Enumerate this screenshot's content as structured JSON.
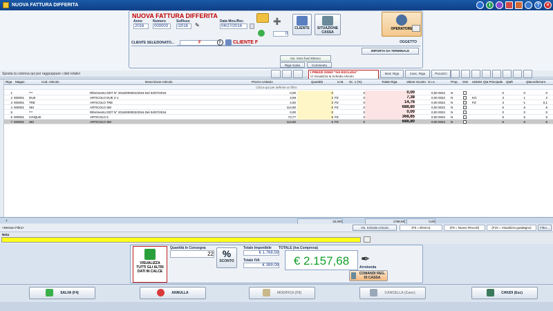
{
  "window": {
    "title": "NUOVA FATTURA DIFFERITA"
  },
  "header": {
    "doc_title": "NUOVA FATTURA DIFFERITA",
    "anno_label": "Anno",
    "anno_value": "2016",
    "numero_label": "Numero",
    "numero_value": "000003",
    "suffisso_label": "Suffisso",
    "suffisso_value": "/2016",
    "data_label": "Data Mov./Rec.",
    "data_value": "04/27/2016",
    "counter_value": "0",
    "cliente_btn": "CLIENTE",
    "situazione_btn": "SITUAZIONE CASSA",
    "operatore_btn": "OPERATORE",
    "cliente_selezionato_label": "CLIENTE SELEZIONATO...",
    "cliente_code": "F",
    "cliente_name": "CLIENTE F",
    "oggetto_label": "OGGETTO",
    "ins_voce_btn": "Ins. Voce fuori Elenco",
    "importa_btn": "IMPORTA DA TERMINALE",
    "riga_vuota_btn": "Riga Vuota",
    "commento_btn": "Commento"
  },
  "toolbar": {
    "group_hint": "Sposta la colonna qui per raggruppare i dati relativi",
    "iva_title": "I PREZZI SONO \"IVA ESCLUSA\"",
    "iva_check_label": "Visualizza la Scheda Articolo",
    "mod_riga": "Mod. Riga",
    "canc_riga": "Canc. Riga",
    "pulisci": "PULISCI"
  },
  "grid": {
    "columns": [
      "Riga",
      "Magaz.",
      "Cod. Articolo",
      "Descrizione Articolo",
      "Prezzo Unitario",
      "Quantità",
      "U.M.",
      "Sc. 1 (%)",
      "Totale Riga",
      "Valore Sconto",
      "S.I.A.",
      "Prop.",
      "Omi",
      "UM",
      "UM",
      "Qta Principale",
      "Qtaft",
      "QtaconfezIonI"
    ],
    "filter_hint": "Clicca qui per definire un filtro",
    "rows": [
      {
        "riga": "1",
        "mag": "",
        "cod": "***",
        "desc": "Riferimento DDT N° 2016/000001/2016 Del 04/07/2016",
        "prezzo": "0,00",
        "qta": "0",
        "um": "",
        "sc": "0",
        "tot": "0,00",
        "vsc": "0,00 0022",
        "prop": "N",
        "qp": "0",
        "qf": "0",
        "qc": "0"
      },
      {
        "riga": "2",
        "mag": "000001",
        "cod": "DUE",
        "desc": "ARTICOLO DUE 2-1",
        "prezzo": "3,69",
        "qta": "2",
        "um": "PZ",
        "sc": "0",
        "tot": "7,38",
        "vsc": "0,00 0022",
        "prop": "N",
        "qp": "3",
        "qf": "1",
        "qc": "2",
        "umx": "KG"
      },
      {
        "riga": "3",
        "mag": "000001",
        "cod": "TRE",
        "desc": "ARTICOLO TRE",
        "prezzo": "4,92",
        "qta": "3",
        "um": "PZ",
        "sc": "0",
        "tot": "14,76",
        "vsc": "0,00 0022",
        "prop": "N",
        "qp": "3",
        "qf": "-1",
        "qc": "0,1",
        "umx": "PZ"
      },
      {
        "riga": "4",
        "mag": "000001",
        "cod": "SEI",
        "desc": "ARTICOLO SEI",
        "prezzo": "114,80",
        "qta": "6",
        "um": "PZ",
        "sc": "0",
        "tot": "688,80",
        "vsc": "0,00 0022",
        "prop": "N",
        "qp": "6",
        "qf": "6",
        "qc": "6"
      },
      {
        "riga": "5",
        "mag": "",
        "cod": "***",
        "desc": "Riferimento DDT N° 2016/000002/2016 Del 04/07/2016",
        "prezzo": "0,00",
        "qta": "0",
        "um": "",
        "sc": "0",
        "tot": "0,00",
        "vsc": "0,00 0022",
        "prop": "N",
        "qp": "0",
        "qf": "0",
        "qc": "0"
      },
      {
        "riga": "6",
        "mag": "000001",
        "cod": "CINQUE",
        "desc": "ARTICOLO 5",
        "prezzo": "73,77",
        "qta": "5",
        "um": "PZ",
        "sc": "0",
        "tot": "368,85",
        "vsc": "0,00 0022",
        "prop": "N",
        "qp": "5",
        "qf": "5",
        "qc": "5"
      },
      {
        "riga": "7",
        "mag": "000001",
        "cod": "SEI",
        "desc": "ARTICOLO SEI",
        "prezzo": "114,80",
        "qta": "6",
        "um": "PZ",
        "sc": "0",
        "tot": "688,80",
        "vsc": "0,00 0022",
        "prop": "N",
        "qp": "6",
        "qf": "6",
        "qc": "6"
      }
    ],
    "footer_count": "7",
    "footer_qta": "22,000",
    "footer_tot": "1768,59",
    "footer_vsc": "0,00"
  },
  "filterbar": {
    "nessun_filtro": "<Nessun Filtro>",
    "vis_scheda": "Vis. Scheda Articolo",
    "f5": "(F5 = Elenco)",
    "f8": "(F8 = Nuovo Record)",
    "f10": "(F10 = Visualizza guadagno)",
    "filtro": "Filtro..."
  },
  "nota_label": "Nota",
  "bottom": {
    "visualizza_btn": "VISUALIZZA TUTTI GLI ALTRI DATI IN CALCE",
    "qta_consegna_label": "Quantità In Consegna",
    "qta_consegna_value": "22",
    "sconto_btn": "SCONTO",
    "tot_imponibile_label": "Totale Imponibile",
    "tot_imponibile_value": "€ 1.768,59",
    "tot_iva_label": "Totale IVA",
    "tot_iva_value": "€ 389,09",
    "totale_label": "TOTALE (Iva Compresa)",
    "totale_value": "€ 2.157,68",
    "arrotonda": "Arrotonda",
    "comandi_btn": "COMANDI REG. DI CASSA"
  },
  "actions": {
    "salva": "SALVA (F4)",
    "annulla": "ANNULLA",
    "modifica": "MODIFICA (F8)",
    "cancella": "CANCELLA (Canc)",
    "chiudi": "CHIUDI (Esc)"
  },
  "colors": {
    "title_red": "#c00000",
    "total_green": "#13a02a",
    "nota_yellow": "#ffff1a"
  }
}
